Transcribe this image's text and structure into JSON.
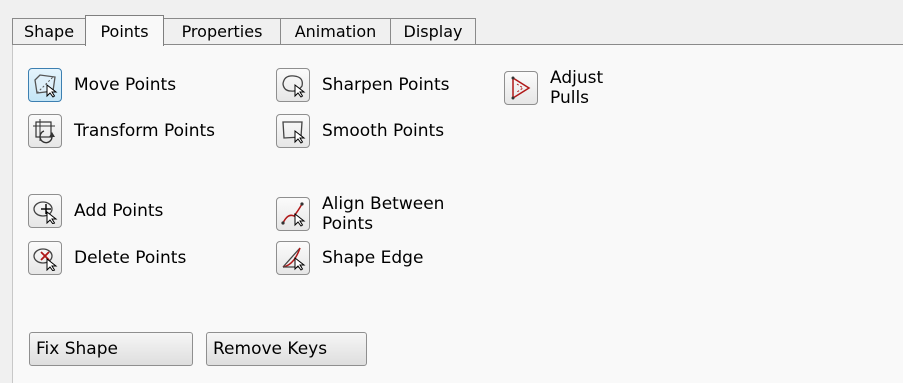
{
  "tabs": [
    {
      "label": "Shape"
    },
    {
      "label": "Points"
    },
    {
      "label": "Properties"
    },
    {
      "label": "Animation"
    },
    {
      "label": "Display"
    }
  ],
  "active_tab": "Points",
  "tools": {
    "move_points": "Move Points",
    "transform_points": "Transform Points",
    "add_points": "Add Points",
    "delete_points": "Delete Points",
    "sharpen_points": "Sharpen Points",
    "smooth_points": "Smooth Points",
    "align_between_points_line1": "Align Between",
    "align_between_points_line2": "Points",
    "shape_edge": "Shape Edge",
    "adjust_pulls_line1": "Adjust",
    "adjust_pulls_line2": "Pulls"
  },
  "buttons": {
    "fix_shape": "Fix Shape",
    "remove_keys": "Remove Keys"
  },
  "colors": {
    "accent_red": "#b01818",
    "selected_blue": "#3c7fb1"
  }
}
